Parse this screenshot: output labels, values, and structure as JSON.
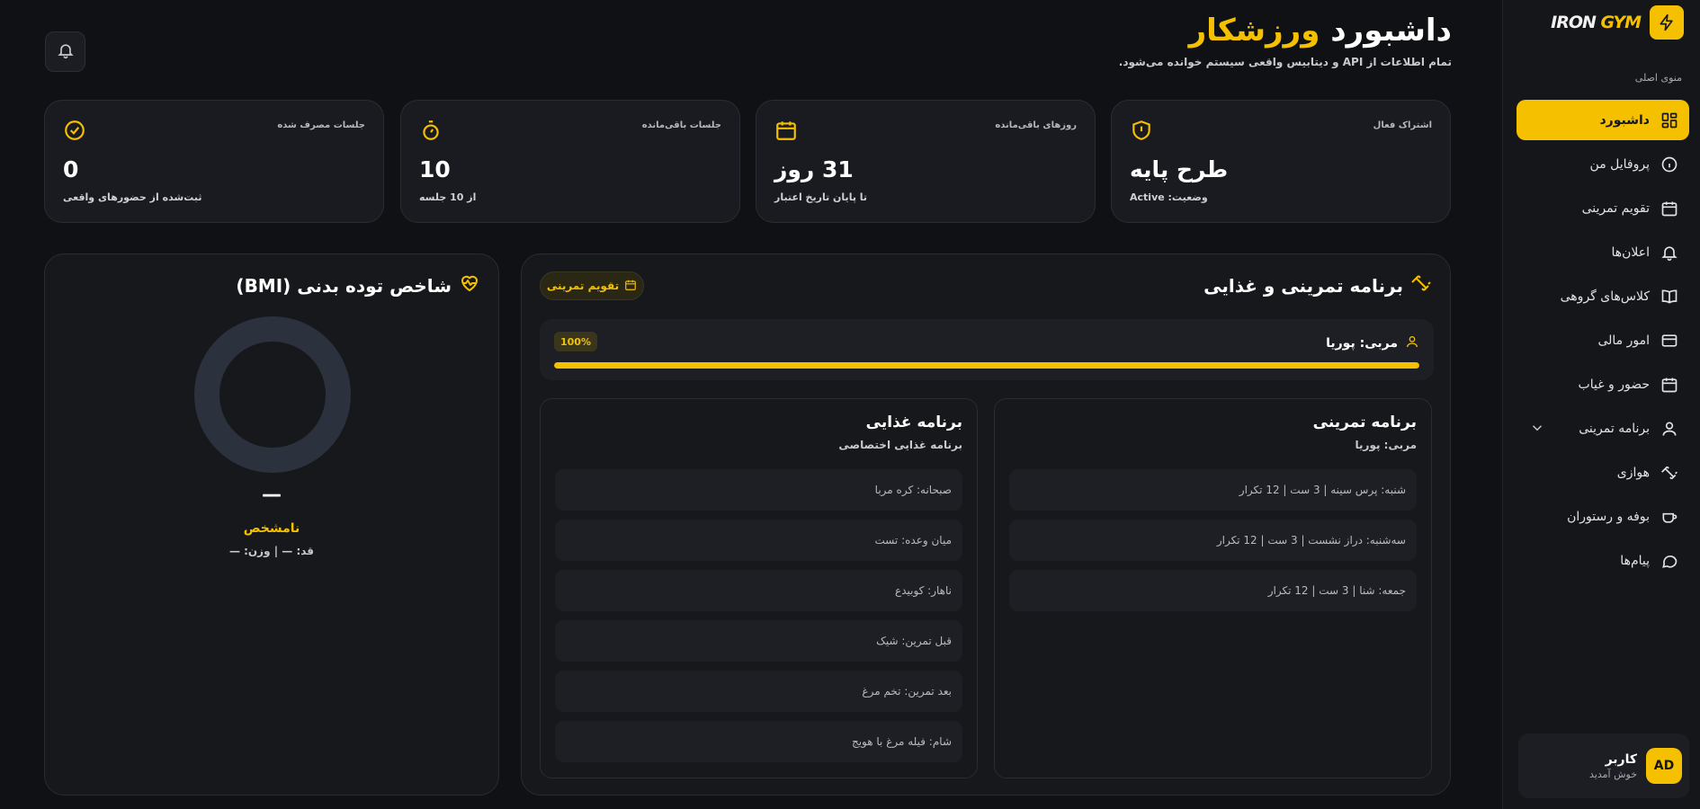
{
  "brand": {
    "name_part1": "IRON ",
    "name_part2": "GYM",
    "icon": "lightning-icon"
  },
  "sidebar": {
    "menu_title": "منوی اصلی",
    "items": [
      {
        "label": "داشبورد",
        "icon": "dashboard-grid-icon",
        "active": true
      },
      {
        "label": "پروفایل من",
        "icon": "info-icon"
      },
      {
        "label": "تقویم تمرینی",
        "icon": "calendar-icon"
      },
      {
        "label": "اعلان‌ها",
        "icon": "bell-icon"
      },
      {
        "label": "کلاس‌های گروهی",
        "icon": "book-icon"
      },
      {
        "label": "امور مالی",
        "icon": "credit-card-icon"
      },
      {
        "label": "حضور و غیاب",
        "icon": "calendar-icon"
      },
      {
        "label": "برنامه تمرینی",
        "icon": "user-icon",
        "has_submenu": true
      },
      {
        "label": "هوازی",
        "icon": "dumbbell-icon"
      },
      {
        "label": "بوفه و رستوران",
        "icon": "cup-icon"
      },
      {
        "label": "پیام‌ها",
        "icon": "message-icon"
      }
    ],
    "user": {
      "initials": "AD",
      "name": "کاربر",
      "greeting": "خوش آمدید"
    }
  },
  "header": {
    "title_main": "داشبورد",
    "title_accent": "ورزشکار",
    "subtitle": "تمام اطلاعات از API و دیتابیس واقعی سیستم خوانده می‌شود."
  },
  "stats": [
    {
      "label": "اشتراک فعال",
      "value": "طرح پایه",
      "foot": "وضعیت: Active",
      "icon": "shield-alert-icon"
    },
    {
      "label": "روزهای باقی‌مانده",
      "value": "31 روز",
      "foot": "تا پایان تاریخ اعتبار",
      "icon": "calendar-icon"
    },
    {
      "label": "جلسات باقی‌مانده",
      "value": "10",
      "foot": "از 10 جلسه",
      "icon": "timer-icon"
    },
    {
      "label": "جلسات مصرف شده",
      "value": "0",
      "foot": "ثبت‌شده از حضورهای واقعی",
      "icon": "check-circle-icon"
    }
  ],
  "program": {
    "title": "برنامه تمرینی و غذایی",
    "calendar_button": "تقویم تمرینی",
    "coach": "مربی: پوریا",
    "progress_label": "100%",
    "progress": 100,
    "workout": {
      "title": "برنامه تمرینی",
      "subtitle": "مربی: پوریا",
      "rows": [
        "شنبه: پرس سینه | 3 ست | 12 تکرار",
        "سه‌شنبه: دراز نشست | 3 ست | 12 تکرار",
        "جمعه: شنا | 3 ست | 12 تکرار"
      ]
    },
    "diet": {
      "title": "برنامه غذایی",
      "subtitle": "برنامه غذایی اختصاصی",
      "rows": [
        "صبحانه: کره مربا",
        "میان وعده: تست",
        "ناهار: کوبیدع",
        "قبل تمرین: شیک",
        "بعد تمرین: تخم مرغ",
        "شام: فیله مرغ با هویج"
      ]
    }
  },
  "bmi": {
    "title": "شاخص توده بدنی (BMI)",
    "value": "—",
    "status": "نامشخص",
    "info": "قد: — | وزن: —"
  },
  "colors": {
    "accent": "#f5c000",
    "background": "#101114",
    "card": "#191b20"
  }
}
